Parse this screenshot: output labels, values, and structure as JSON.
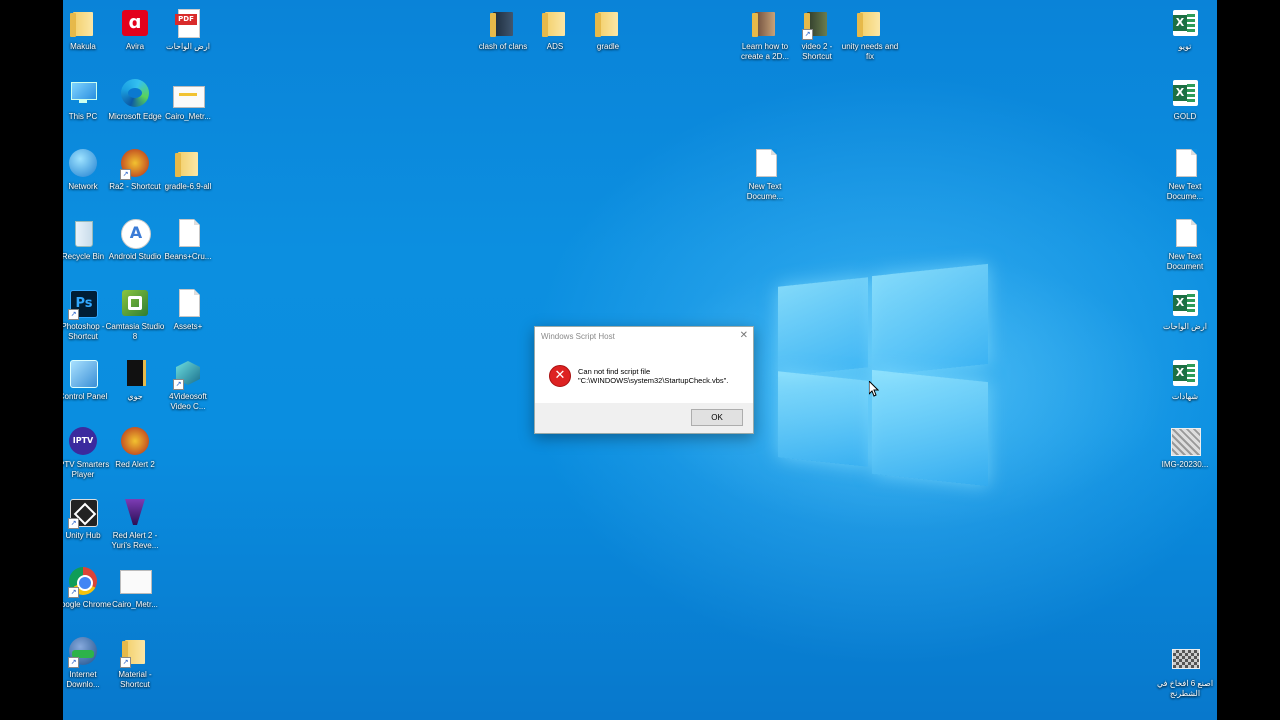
{
  "desktop": {
    "icons": {
      "makula": "Makula",
      "avira": "Avira",
      "pdf_label": "PDF",
      "arz_alwahat_pdf": "ارض الواحات",
      "this_pc": "This PC",
      "edge": "Microsoft Edge",
      "cairo_metro_1": "Cairo_Metr...",
      "network": "Network",
      "ra2_shortcut": "Ra2 - Shortcut",
      "gradle_all": "gradle-6.9-all",
      "recycle_bin": "Recycle Bin",
      "android_studio": "Android Studio",
      "beans": "Beans+Cru...",
      "photoshop": "Photoshop - Shortcut",
      "ps_label": "Ps",
      "camtasia": "Camtasia Studio 8",
      "assets": "Assets+",
      "control_panel": "Control Panel",
      "juju": "جوي",
      "videosoft": "4Videosoft Video C...",
      "iptv": "IPTV Smarters Player",
      "iptv_label": "IPTV",
      "red_alert_2": "Red Alert 2",
      "unity_hub": "Unity Hub",
      "red_alert_yuri": "Red Alert 2 - Yuri's Reve...",
      "chrome": "Google Chrome",
      "cairo_metro_2": "Cairo_Metr...",
      "idm": "Internet Downlo...",
      "material": "Material - Shortcut",
      "clash_of_clans": "clash of clans",
      "ads": "ADS",
      "gradle": "gradle",
      "learn_2d": "Learn how to create a 2D...",
      "video2": "video 2 - Shortcut",
      "unity_needs": "unity needs and fix",
      "new_text_doc_mid": "New Text Docume...",
      "toyo": "تويو",
      "gold": "GOLD",
      "new_text_doc_r1": "New Text Docume...",
      "new_text_doc_r2": "New Text Document",
      "arz_alwahat_xl": "ارض الواحات",
      "shahadat": "شهادات",
      "img_2023": "IMG-20230...",
      "chess": "اصنع 6 افخاخ في الشطرنج",
      "xl_letter": "X"
    }
  },
  "dialog": {
    "title": "Windows Script Host",
    "close_glyph": "✕",
    "error_glyph": "✕",
    "message_line1": "Can not find script file",
    "message_line2": "\"C:\\WINDOWS\\system32\\StartupCheck.vbs\".",
    "ok_label": "OK"
  },
  "colors": {
    "wallpaper": "#0a8ee0",
    "error_red": "#dd2222",
    "excel_green": "#1d7044"
  }
}
